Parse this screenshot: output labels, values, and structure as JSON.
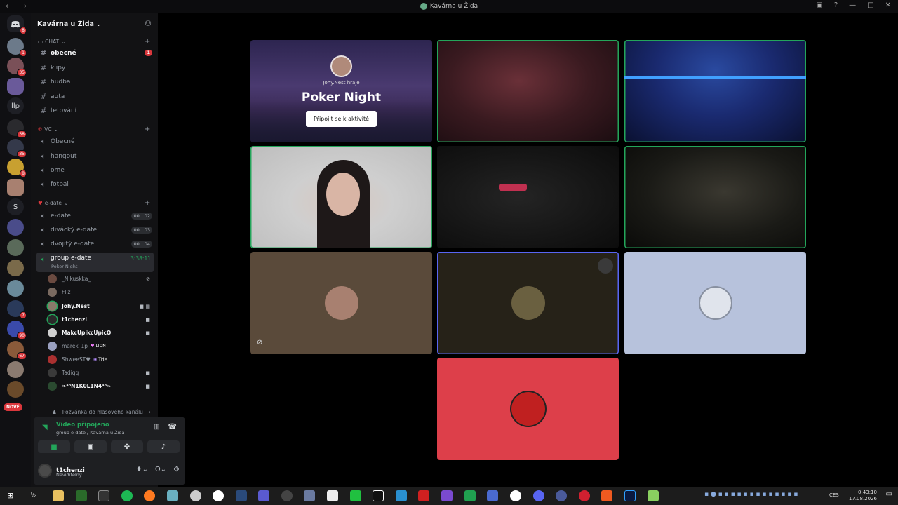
{
  "window": {
    "title": "Kavárna u Žida",
    "nav": "← →"
  },
  "server_list": {
    "badges": [
      "8",
      "1",
      "35",
      "38",
      "35",
      "8",
      "7",
      "90",
      "67"
    ],
    "text_server_1": "llp",
    "text_server_2": "S",
    "new_label": "NOVÉ"
  },
  "guild": {
    "name": "Kavárna u Žida"
  },
  "categories": {
    "chat": "CHAT",
    "vc": "VC",
    "edate": "e-date"
  },
  "channels": {
    "obecne": "obecné",
    "obecne_badge": "1",
    "klipy": "klipy",
    "hudba": "hudba",
    "auta": "auta",
    "tetovani": "tetování",
    "vc_obecne": "Obecné",
    "hangout": "hangout",
    "ome": "ome",
    "fotbal": "fotbal",
    "edate": "e-date",
    "edate_a": "00",
    "edate_b": "02",
    "divacky": "divácký e-date",
    "divacky_a": "00",
    "divacky_b": "03",
    "dvojity": "dvojitý e-date",
    "dvojity_a": "00",
    "dvojity_b": "04",
    "group": "group e-date",
    "group_timer": "3:38:11",
    "group_activity": "Poker Night"
  },
  "voice_members": [
    {
      "name": "_Nikuskka_"
    },
    {
      "name": "Fliz"
    },
    {
      "name": "Johy.Nest"
    },
    {
      "name": "t1chenzi"
    },
    {
      "name": "MakcUpikcUpicO"
    },
    {
      "name": "marek_1p",
      "tag": "LION"
    },
    {
      "name": "ShweeST♥",
      "tag": "THM"
    },
    {
      "name": "Tadiqq"
    },
    {
      "name": "❧ᵃⁿN1K0L1N4ᵃⁿ❧"
    }
  ],
  "invite": "Pozvánka do hlasového kanálu",
  "voice_panel": {
    "status": "Video připojeno",
    "location": "group e-date / Kavárna u Žida"
  },
  "user": {
    "name": "t1chenzi",
    "status": "Neviditelný"
  },
  "activity": {
    "host": "Johy.Nest hraje",
    "title": "Poker Night",
    "join": "Připojit se k aktivitě"
  },
  "clock": {
    "time": "0:43:10",
    "date": "17.08.2026",
    "lang": "CES"
  },
  "colors": {
    "accent_green": "#23a55a",
    "danger": "#da373c",
    "blurple": "#5865f2",
    "red_tile": "#dd3f4a"
  }
}
